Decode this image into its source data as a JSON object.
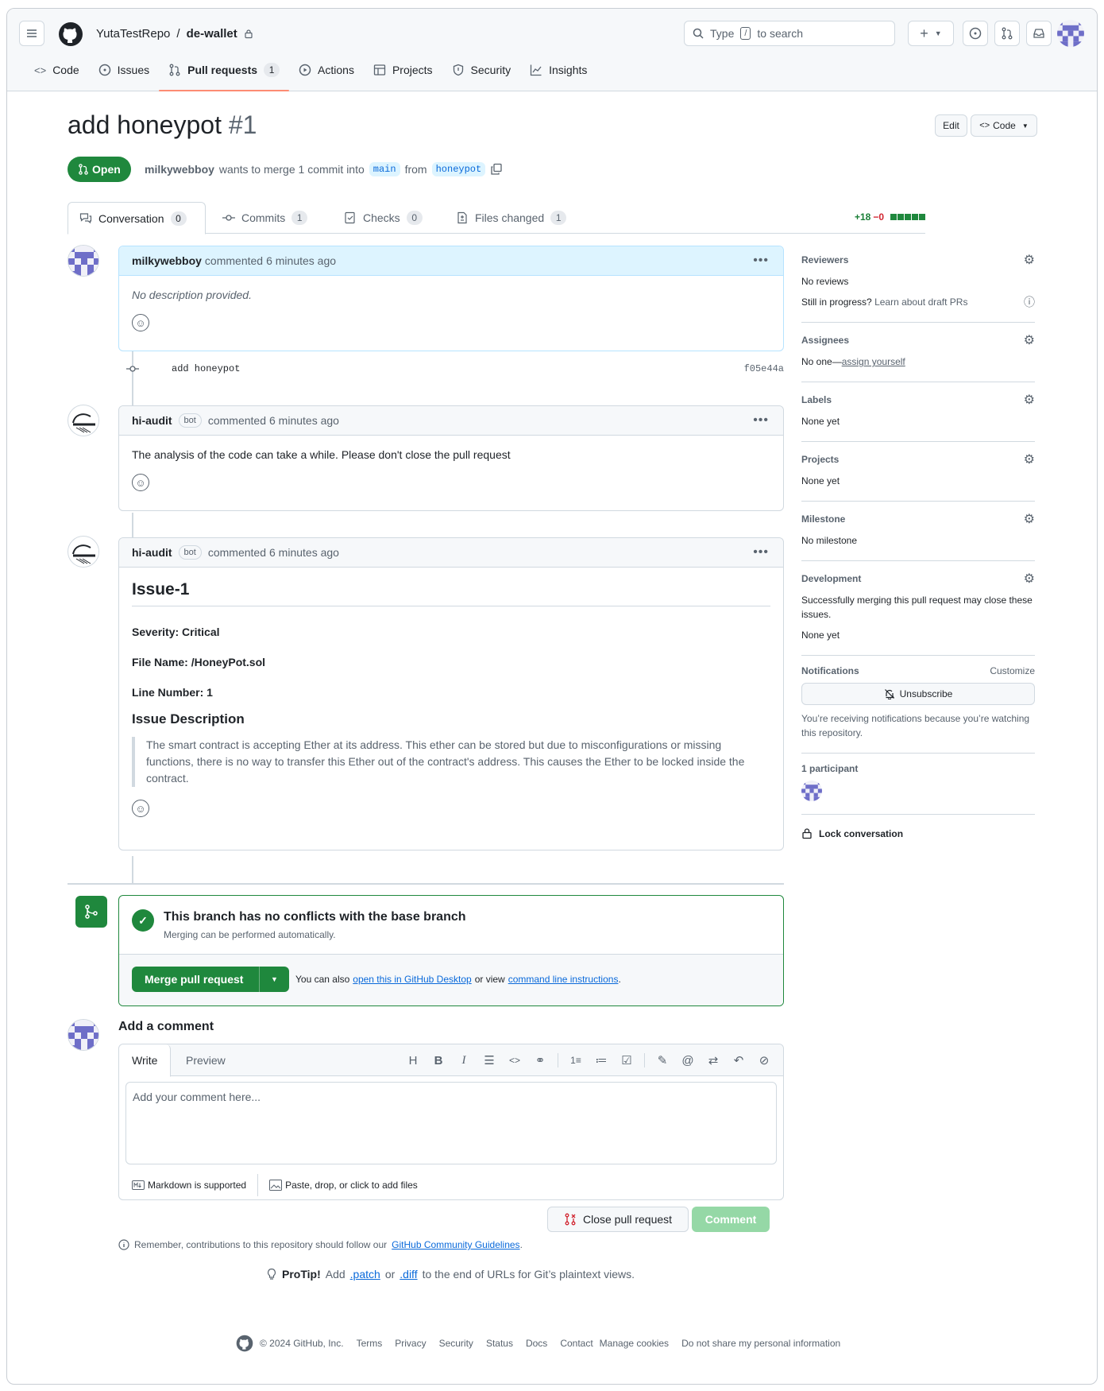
{
  "header": {
    "owner": "YutaTestRepo",
    "separator": "/",
    "repo": "de-wallet",
    "search_prefix": "Type",
    "search_key": "/",
    "search_suffix": "to search"
  },
  "nav": {
    "items": [
      {
        "label": "Code",
        "icon": "code-icon"
      },
      {
        "label": "Issues",
        "icon": "issue-icon"
      },
      {
        "label": "Pull requests",
        "icon": "pull-request-icon",
        "count": "1",
        "active": true
      },
      {
        "label": "Actions",
        "icon": "play-icon"
      },
      {
        "label": "Projects",
        "icon": "table-icon"
      },
      {
        "label": "Security",
        "icon": "shield-icon"
      },
      {
        "label": "Insights",
        "icon": "graph-icon"
      }
    ]
  },
  "pr": {
    "title": "add honeypot",
    "number": "#1",
    "edit_label": "Edit",
    "code_label": "Code",
    "state": "Open",
    "author": "milkywebboy",
    "merge_text": "wants to merge 1 commit into",
    "base": "main",
    "from_text": "from",
    "head": "honeypot"
  },
  "tabs": [
    {
      "label": "Conversation",
      "count": "0"
    },
    {
      "label": "Commits",
      "count": "1"
    },
    {
      "label": "Checks",
      "count": "0"
    },
    {
      "label": "Files changed",
      "count": "1"
    }
  ],
  "diffstat": {
    "additions": "+18",
    "deletions": "−0"
  },
  "comments": [
    {
      "author": "milkywebboy",
      "action": "commented",
      "time": "6 minutes ago",
      "body": "No description provided."
    },
    {
      "author": "hi-audit",
      "badge": "bot",
      "action": "commented",
      "time": "6 minutes ago",
      "body": "The analysis of the code can take a while. Please don't close the pull request"
    },
    {
      "author": "hi-audit",
      "badge": "bot",
      "action": "commented",
      "time": "6 minutes ago",
      "heading": "Issue-1",
      "severity": "Severity: Critical",
      "file": "File Name: /HoneyPot.sol",
      "line": "Line Number: 1",
      "desc_heading": "Issue Description",
      "desc": "The smart contract is accepting Ether at its address. This ether can be stored but due to misconfigurations or missing functions, there is no way to transfer this Ether out of the contract's address. This causes the Ether to be locked inside the contract."
    }
  ],
  "commit": {
    "message": "add honeypot",
    "sha": "f05e44a"
  },
  "sidebar": {
    "reviewers_title": "Reviewers",
    "reviewers_value": "No reviews",
    "draft_text": "Still in progress?",
    "draft_link": "Learn about draft PRs",
    "assignees_title": "Assignees",
    "assignees_value": "No one—",
    "assign_link": "assign yourself",
    "labels_title": "Labels",
    "labels_value": "None yet",
    "projects_title": "Projects",
    "projects_value": "None yet",
    "milestone_title": "Milestone",
    "milestone_value": "No milestone",
    "development_title": "Development",
    "development_desc": "Successfully merging this pull request may close these issues.",
    "development_value": "None yet",
    "notifications_title": "Notifications",
    "customize": "Customize",
    "unsubscribe": "Unsubscribe",
    "notif_reason": "You’re receiving notifications because you’re watching this repository.",
    "participants_title": "1 participant",
    "lock": "Lock conversation"
  },
  "merge": {
    "title": "This branch has no conflicts with the base branch",
    "subtitle": "Merging can be performed automatically.",
    "button": "Merge pull request",
    "also_text": "You can also",
    "desktop_link": "open this in GitHub Desktop",
    "or_view": "or view",
    "cli_link": "command line instructions",
    "period": "."
  },
  "editor": {
    "title": "Add a comment",
    "write": "Write",
    "preview": "Preview",
    "placeholder": "Add your comment here...",
    "markdown": "Markdown is supported",
    "files": "Paste, drop, or click to add files",
    "close_pr": "Close pull request",
    "comment": "Comment"
  },
  "remember": {
    "text": "Remember, contributions to this repository should follow our",
    "link": "GitHub Community Guidelines",
    "period": "."
  },
  "protip": {
    "bold": "ProTip!",
    "pre": "Add",
    "patch": ".patch",
    "or": "or",
    "diff": ".diff",
    "post": "to the end of URLs for Git’s plaintext views."
  },
  "footer": {
    "copyright": "© 2024 GitHub, Inc.",
    "links": [
      "Terms",
      "Privacy",
      "Security",
      "Status",
      "Docs",
      "Contact",
      "Manage cookies",
      "Do not share my personal information"
    ]
  },
  "colors": {
    "open_green": "#1f883d",
    "link_blue": "#0969da",
    "tab_underline": "#fd8c73"
  }
}
